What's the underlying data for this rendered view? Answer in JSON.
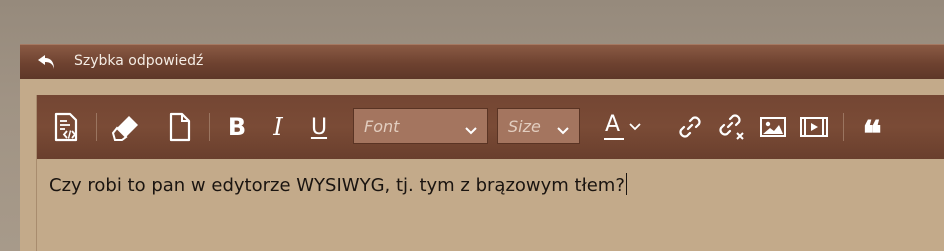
{
  "panel": {
    "title": "Szybka odpowiedź",
    "title_icon": "reply-arrow-icon"
  },
  "toolbar": {
    "buttons": [
      {
        "name": "source-code",
        "icon": "source-code-icon"
      },
      {
        "name": "remove-format",
        "icon": "eraser-icon"
      },
      {
        "name": "new-page",
        "icon": "document-icon"
      },
      {
        "name": "bold",
        "label": "B",
        "icon": "bold-icon"
      },
      {
        "name": "italic",
        "label": "I",
        "icon": "italic-icon"
      },
      {
        "name": "underline",
        "label": "U",
        "icon": "underline-icon"
      },
      {
        "name": "text-color",
        "label": "A",
        "icon": "text-color-icon"
      },
      {
        "name": "link",
        "icon": "link-icon"
      },
      {
        "name": "unlink",
        "icon": "unlink-icon"
      },
      {
        "name": "image",
        "icon": "image-icon"
      },
      {
        "name": "video",
        "icon": "video-icon"
      },
      {
        "name": "blockquote",
        "label": "❝",
        "icon": "quote-icon"
      }
    ],
    "font_select": {
      "value": "Font"
    },
    "size_select": {
      "value": "Size"
    }
  },
  "editor": {
    "content": "Czy robi to pan w edytorze WYSIWYG, tj. tym z brązowym tłem?"
  },
  "colors": {
    "header_bg": "#6e4230",
    "toolbar_bg": "#744633",
    "content_bg": "#c3aa8a",
    "select_bg": "#a4755f",
    "icon_color": "#ffffff"
  }
}
